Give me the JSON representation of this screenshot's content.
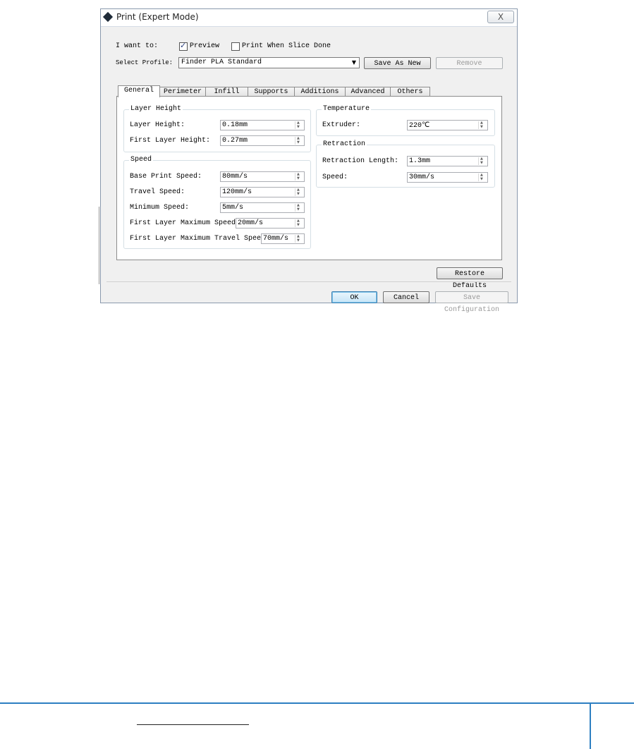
{
  "window": {
    "title": "Print (Expert Mode)",
    "close_label": "X"
  },
  "top": {
    "i_want_to": "I want to:",
    "preview_label": "Preview",
    "preview_checked": true,
    "print_when_done_label": "Print When Slice Done",
    "print_when_done_checked": false,
    "select_profile_label": "Select Profile:",
    "profile_value": "Finder PLA Standard",
    "save_as_new": "Save As New",
    "remove": "Remove"
  },
  "tabs": [
    "General",
    "Perimeter",
    "Infill",
    "Supports",
    "Additions",
    "Advanced",
    "Others"
  ],
  "active_tab": "General",
  "layer_height": {
    "title": "Layer Height",
    "rows": [
      {
        "label": "Layer Height:",
        "value": "0.18mm"
      },
      {
        "label": "First Layer Height:",
        "value": "0.27mm"
      }
    ]
  },
  "speed": {
    "title": "Speed",
    "rows": [
      {
        "label": "Base Print Speed:",
        "value": "80mm/s"
      },
      {
        "label": "Travel Speed:",
        "value": "120mm/s"
      },
      {
        "label": "Minimum Speed:",
        "value": "5mm/s"
      },
      {
        "label": "First Layer Maximum Speed:",
        "value": "20mm/s"
      },
      {
        "label": "First Layer Maximum Travel Speed:",
        "value": "70mm/s"
      }
    ]
  },
  "temperature": {
    "title": "Temperature",
    "rows": [
      {
        "label": "Extruder:",
        "value": "220℃"
      }
    ]
  },
  "retraction": {
    "title": "Retraction",
    "rows": [
      {
        "label": "Retraction Length:",
        "value": "1.3mm"
      },
      {
        "label": "Speed:",
        "value": "30mm/s"
      }
    ]
  },
  "buttons": {
    "restore_defaults": "Restore Defaults",
    "ok": "OK",
    "cancel": "Cancel",
    "save_configuration": "Save Configuration"
  },
  "colors": {
    "footer_rule": "#2d7fc1",
    "window_border": "#8a99ad"
  }
}
